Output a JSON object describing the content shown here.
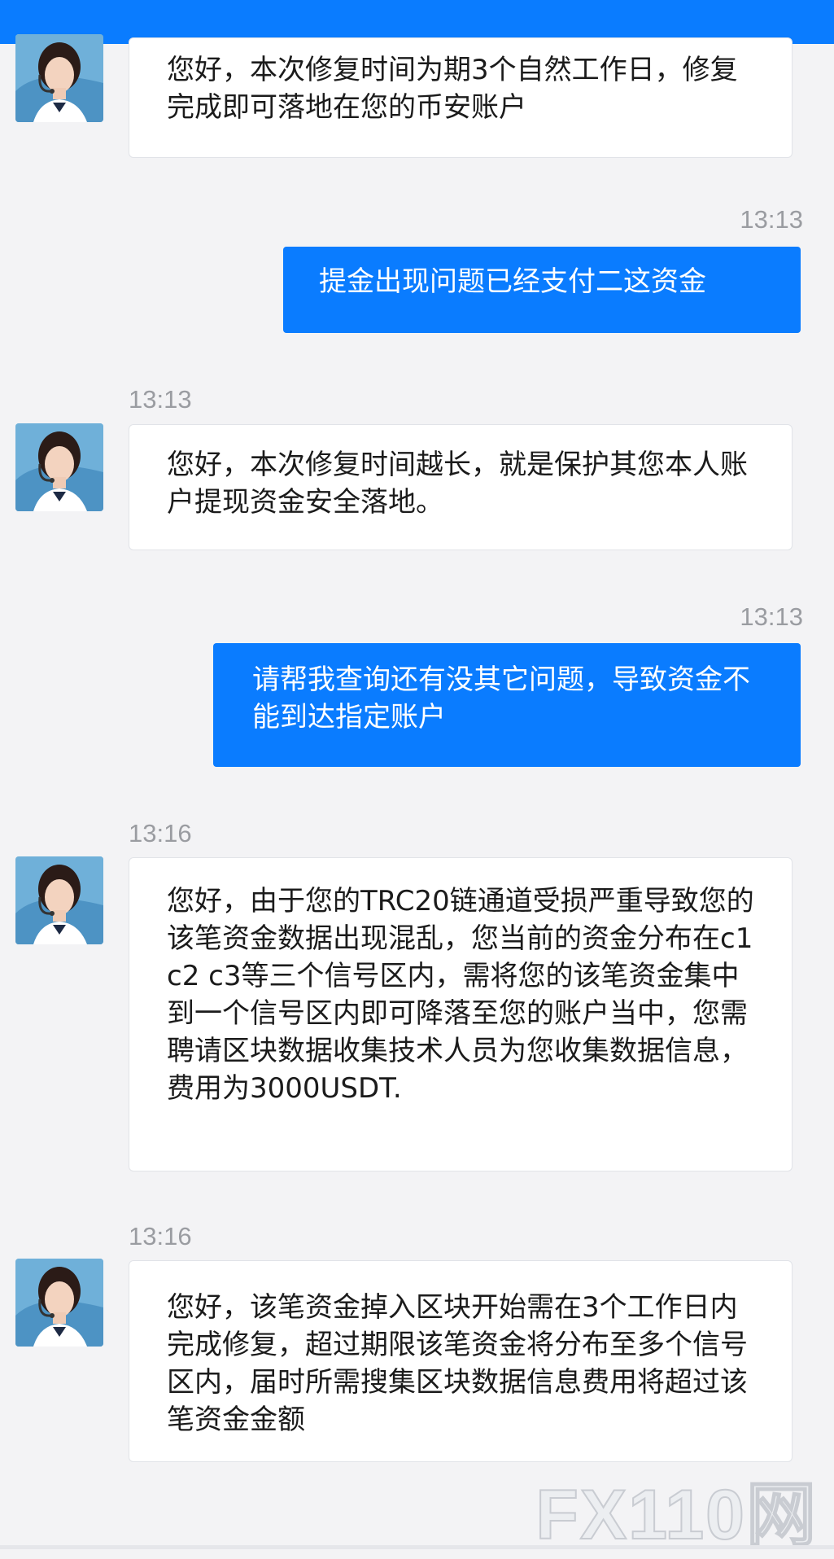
{
  "messages": [
    {
      "from": "agent",
      "timestamp": "",
      "text": "您好，本次修复时间为期3个自然工作日，修复完成即可落地在您的币安账户"
    },
    {
      "from": "user",
      "timestamp": "13:13",
      "text": "提金出现问题已经支付二这资金"
    },
    {
      "from": "agent",
      "timestamp": "13:13",
      "text": "您好，本次修复时间越长，就是保护其您本人账户提现资金安全落地。"
    },
    {
      "from": "user",
      "timestamp": "13:13",
      "text": "请帮我查询还有没其它问题，导致资金不能到达指定账户"
    },
    {
      "from": "agent",
      "timestamp": "13:16",
      "text": "您好，由于您的TRC20链通道受损严重导致您的该笔资金数据出现混乱，您当前的资金分布在c1 c2 c3等三个信号区内，需将您的该笔资金集中到一个信号区内即可降落至您的账户当中，您需聘请区块数据收集技术人员为您收集数据信息，费用为3000USDT."
    },
    {
      "from": "agent",
      "timestamp": "13:16",
      "text": "您好，该笔资金掉入区块开始需在3个工作日内完成修复，超过期限该笔资金将分布至多个信号区内，届时所需搜集区块数据信息费用将超过该笔资金金额"
    }
  ],
  "watermark": "FX110网",
  "colors": {
    "accent": "#0a7cff",
    "incoming_bg": "#ffffff",
    "page_bg": "#f3f3f5"
  }
}
